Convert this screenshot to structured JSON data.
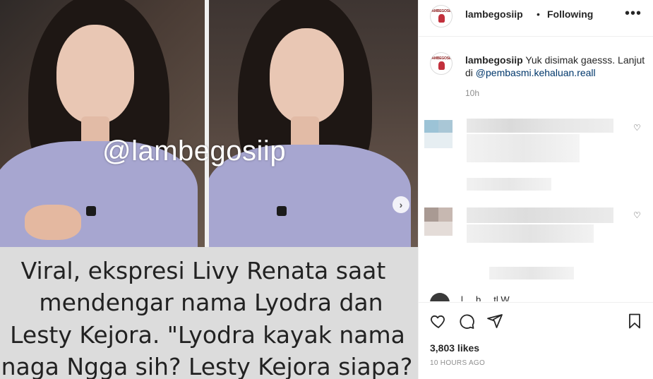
{
  "media": {
    "watermark": "@lambegosiip",
    "caption_lines": [
      "Viral, ekspresi Livy Renata saat",
      "mendengar nama Lyodra dan",
      "Lesty Kejora. \"Lyodra kayak nama",
      "naga Ngga sih? Lesty Kejora siapa?"
    ],
    "next_icon": "chevron-right-icon",
    "next_glyph": "›"
  },
  "header": {
    "username": "lambegosiip",
    "separator": "•",
    "follow_status": "Following",
    "more_glyph": "•••"
  },
  "caption": {
    "username": "lambegosiip",
    "text": "Yuk disimak gaesss. Lanjut di ",
    "mention": "@pembasmi.kehaluan.reall",
    "time": "10h"
  },
  "comments": {
    "reply_glyph": "♡",
    "truncated_text": "l ... b ... tl W ..."
  },
  "actions": {
    "likes": "3,803 likes",
    "time_ago": "10 HOURS AGO"
  },
  "colors": {
    "text": "#262626",
    "secondary": "#8e8e8e",
    "link": "#00376b",
    "border": "#efefef"
  }
}
